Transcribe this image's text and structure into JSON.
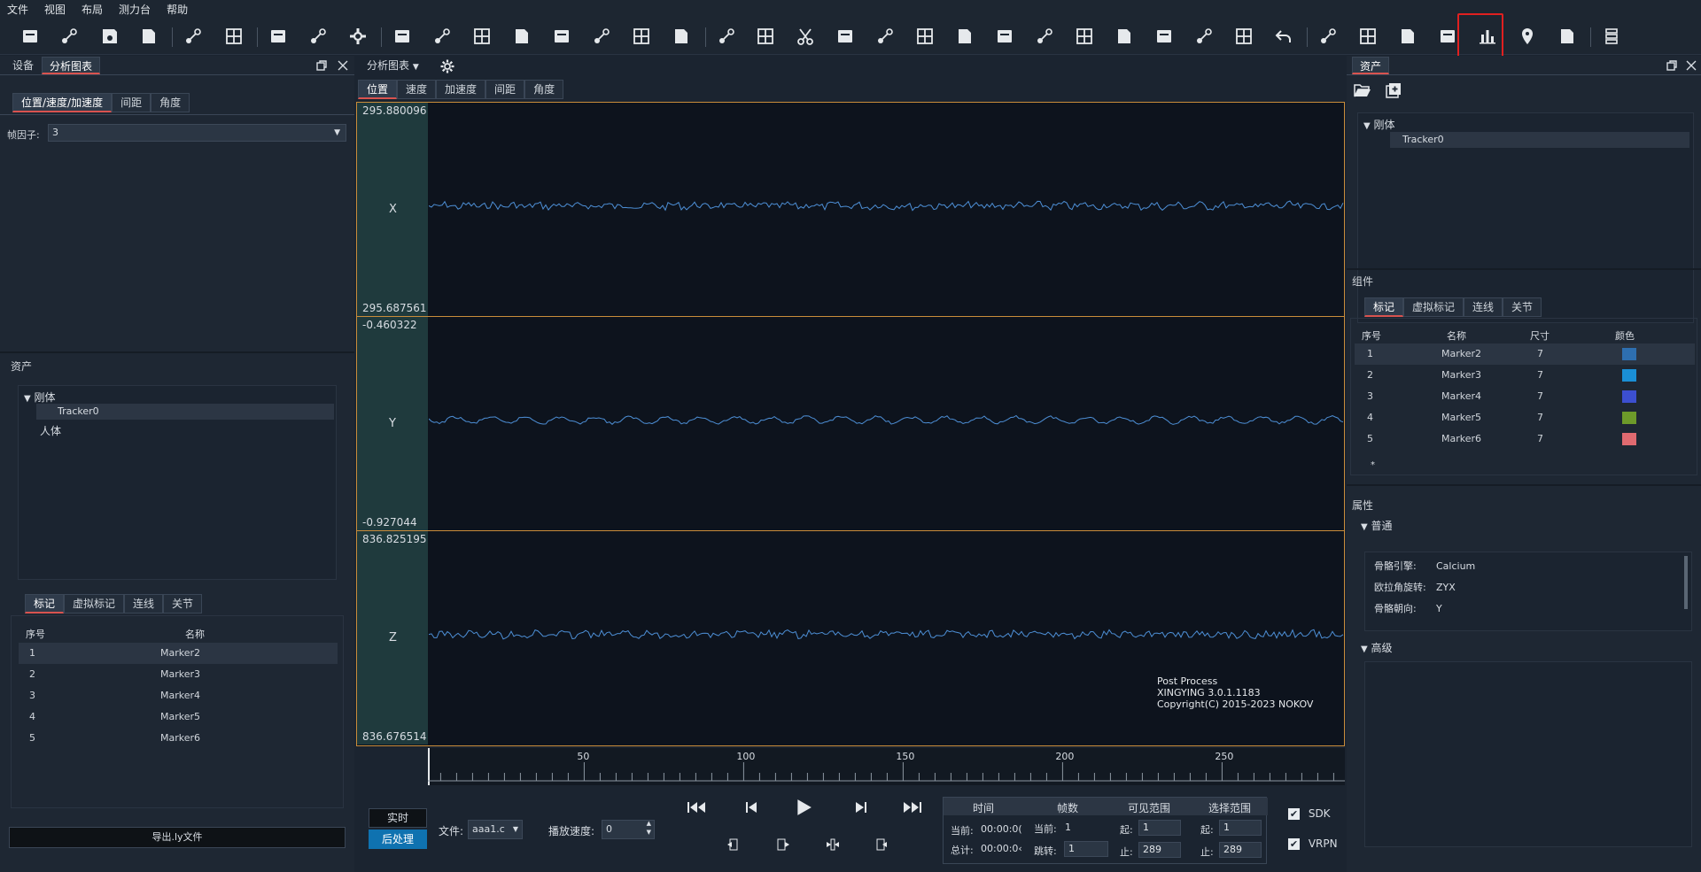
{
  "menu": [
    "文件",
    "视图",
    "布局",
    "测力台",
    "帮助"
  ],
  "left_panel": {
    "tabs": [
      "设备",
      "分析图表"
    ],
    "subtabs": [
      "位置/速度/加速度",
      "间距",
      "角度"
    ],
    "frame_factor_label": "帧因子:",
    "frame_factor_value": "3",
    "assets_title": "资产",
    "tree_rigid": "刚体",
    "tree_tracker": "Tracker0",
    "tree_human": "人体",
    "bottom_tabs": [
      "标记",
      "虚拟标记",
      "连线",
      "关节"
    ],
    "col_index": "序号",
    "col_name": "名称",
    "markers": [
      {
        "idx": "1",
        "name": "Marker2"
      },
      {
        "idx": "2",
        "name": "Marker3"
      },
      {
        "idx": "3",
        "name": "Marker4"
      },
      {
        "idx": "4",
        "name": "Marker5"
      },
      {
        "idx": "5",
        "name": "Marker6"
      }
    ],
    "export_button": "导出.ly文件"
  },
  "center": {
    "title": "分析图表",
    "tabs": [
      "位置",
      "速度",
      "加速度",
      "间距",
      "角度"
    ],
    "rows": [
      {
        "axis": "X",
        "max": "295.880096",
        "min": "295.687561"
      },
      {
        "axis": "Y",
        "max": "-0.460322",
        "min": "-0.927044"
      },
      {
        "axis": "Z",
        "max": "836.825195",
        "min": "836.676514"
      }
    ],
    "watermark_line1": "Post Process",
    "watermark_line2": "XINGYING 3.0.1.1183",
    "watermark_line3": "Copyright(C) 2015-2023 NOKOV",
    "timeline_ticks": [
      "50",
      "100",
      "150",
      "200",
      "250"
    ]
  },
  "bottom": {
    "mode_realtime": "实时",
    "mode_post": "后处理",
    "file_label": "文件:",
    "file_value": "aaa1.c",
    "speed_label": "播放速度:",
    "speed_value": "0",
    "time_header": "时间",
    "frames_header": "帧数",
    "visible_range_header": "可见范围",
    "select_range_header": "选择范围",
    "current_label": "当前:",
    "total_label": "总计:",
    "current_time": "00:00:0(",
    "total_time": "00:00:0‹",
    "frame_current_label": "当前:",
    "frame_current": "1",
    "jump_label": "跳转:",
    "jump_value": "1",
    "start_label": "起:",
    "end_label": "止:",
    "visible_start": "1",
    "visible_end": "289",
    "select_start": "1",
    "select_end": "289",
    "sdk_label": "SDK",
    "vrpn_label": "VRPN"
  },
  "right_panel": {
    "title": "资产",
    "tree_rigid": "刚体",
    "tree_tracker": "Tracker0",
    "components_title": "组件",
    "tabs": [
      "标记",
      "虚拟标记",
      "连线",
      "关节"
    ],
    "col_index": "序号",
    "col_name": "名称",
    "col_size": "尺寸",
    "col_color": "颜色",
    "markers": [
      {
        "idx": "1",
        "name": "Marker2",
        "size": "7",
        "color": "#2e6fb0"
      },
      {
        "idx": "2",
        "name": "Marker3",
        "size": "7",
        "color": "#1a8fd6"
      },
      {
        "idx": "3",
        "name": "Marker4",
        "size": "7",
        "color": "#3c4fd0"
      },
      {
        "idx": "4",
        "name": "Marker5",
        "size": "7",
        "color": "#6d9a2a"
      },
      {
        "idx": "5",
        "name": "Marker6",
        "size": "7",
        "color": "#e06a70"
      }
    ],
    "new_row": "*",
    "props_title": "属性",
    "general_section": "普通",
    "props": [
      {
        "label": "骨骼引擎:",
        "value": "Calcium"
      },
      {
        "label": "欧拉角旋转:",
        "value": "ZYX"
      },
      {
        "label": "骨骼朝向:",
        "value": "Y"
      }
    ],
    "advanced_section": "高级"
  },
  "colors": {
    "accent_red": "#e02020",
    "plot_border": "#c98c3a",
    "signal": "#4d8fd6"
  }
}
